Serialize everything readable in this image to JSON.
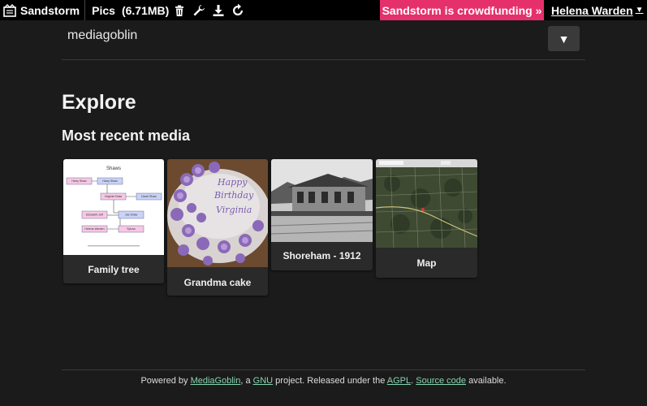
{
  "topbar": {
    "brand": "Sandstorm",
    "grain_title": "Pics",
    "grain_size": "(6.71MB)",
    "crowdfunding": "Sandstorm is crowdfunding »",
    "account": "Helena Warden"
  },
  "header": {
    "site_name": "mediagoblin",
    "dropdown": "▼"
  },
  "main": {
    "title": "Explore",
    "section_title": "Most recent media",
    "media": [
      {
        "title": "Family tree"
      },
      {
        "title": "Grandma cake",
        "thumb_text": [
          "Happy",
          "Birthday",
          "Virginia"
        ]
      },
      {
        "title": "Shoreham - 1912"
      },
      {
        "title": "Map"
      }
    ],
    "family_tree_thumb": {
      "title": "Shaws",
      "nodes": [
        "Harry Shaw",
        "Harry Shaw",
        "Virginia Shaw",
        "David Shaw",
        "Joe Shaw",
        "Elizabeth Jeff",
        "Helena Warden",
        "Sylvan"
      ]
    }
  },
  "footer": {
    "prefix": "Powered by ",
    "mediagoblin": "MediaGoblin",
    "mid1": ", a ",
    "gnu": "GNU",
    "mid2": " project. Released under the ",
    "agpl": "AGPL",
    "mid3": ". ",
    "source": "Source code",
    "suffix": " available."
  },
  "colors": {
    "background": "#1b1b1b",
    "crowdfund": "#e5306c",
    "link": "#86d4b1"
  }
}
